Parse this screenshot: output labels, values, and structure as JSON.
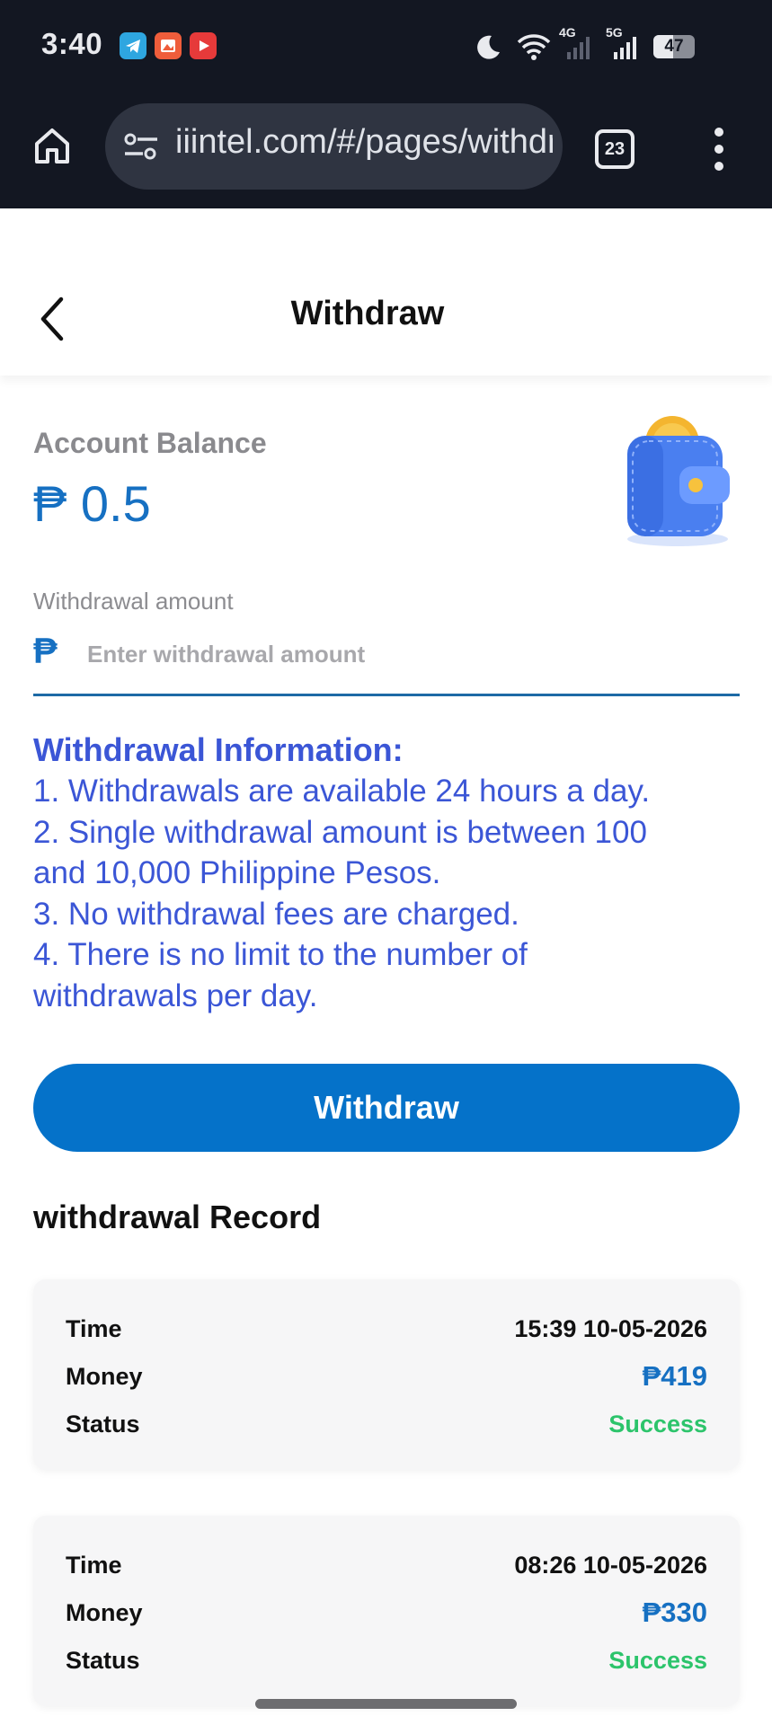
{
  "status_bar": {
    "time": "3:40",
    "apps": [
      "telegram-icon",
      "puzzle-app-icon",
      "youtube-icon"
    ],
    "network_labels": [
      "4G",
      "5G"
    ],
    "battery": "47"
  },
  "browser": {
    "url": "iiintel.com/#/pages/withdraw",
    "tab_count": "23"
  },
  "header": {
    "title": "Withdraw"
  },
  "balance": {
    "label": "Account Balance",
    "value": "₱ 0.5"
  },
  "withdrawal_form": {
    "label": "Withdrawal amount",
    "currency_symbol": "₱",
    "placeholder": "Enter withdrawal amount"
  },
  "info": {
    "title": "Withdrawal Information:",
    "lines": [
      "1. Withdrawals are available 24 hours a day.",
      "2. Single withdrawal amount is between 100",
      "and 10,000 Philippine Pesos.",
      "3. No withdrawal fees are charged.",
      "4. There is no limit to the number of",
      "withdrawals per day."
    ]
  },
  "withdraw_button": "Withdraw",
  "records": {
    "title": "withdrawal Record",
    "keys": {
      "time": "Time",
      "money": "Money",
      "status": "Status"
    },
    "items": [
      {
        "time": "15:39 10-05-2026",
        "money": "₱419",
        "status": "Success"
      },
      {
        "time": "08:26 10-05-2026",
        "money": "₱330",
        "status": "Success"
      }
    ]
  },
  "colors": {
    "accent": "#0572c9",
    "info_text": "#3b56d6",
    "success": "#2cc46b",
    "chrome_bg": "#131722"
  }
}
